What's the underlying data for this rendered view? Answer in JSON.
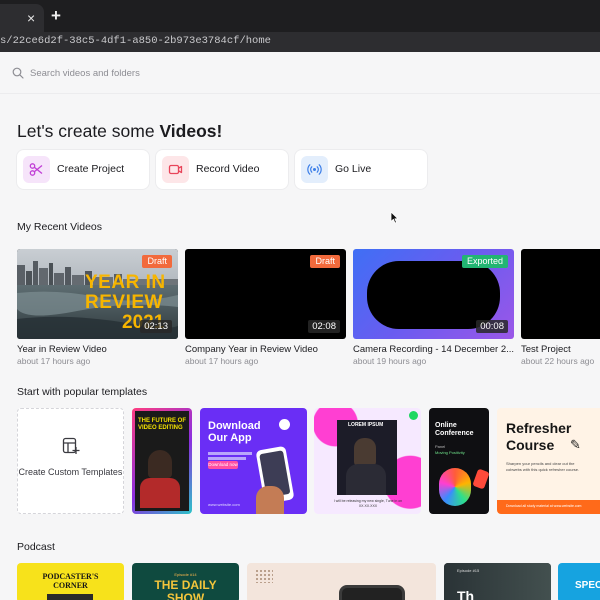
{
  "browser": {
    "tab_close": "×",
    "new_tab": "+",
    "url": "s/22ce6d2f-38c5-4df1-a850-2b973e3784cf/home"
  },
  "search": {
    "placeholder": "Search videos and folders"
  },
  "headline": {
    "prefix": "Let's create some ",
    "emphasis": "Videos!"
  },
  "actions": [
    {
      "label": "Create Project",
      "icon": "scissors-icon",
      "color": "#c13fd6"
    },
    {
      "label": "Record Video",
      "icon": "camera-icon",
      "color": "#e8455a"
    },
    {
      "label": "Go Live",
      "icon": "broadcast-icon",
      "color": "#3b7ee8"
    }
  ],
  "recent": {
    "title": "My Recent Videos",
    "videos": [
      {
        "title": "Year in Review Video",
        "meta": "about 17 hours ago",
        "badge": "Draft",
        "duration": "02:13",
        "thumb_lines": [
          "YEAR IN",
          "REVIEW",
          "2021"
        ]
      },
      {
        "title": "Company Year in Review Video",
        "meta": "about 17 hours ago",
        "badge": "Draft",
        "duration": "02:08"
      },
      {
        "title": "Camera Recording - 14 December 2...",
        "meta": "about 19 hours ago",
        "badge": "Exported",
        "duration": "00:08"
      },
      {
        "title": "Test Project",
        "meta": "about 22 hours ago"
      }
    ]
  },
  "templates": {
    "title": "Start with popular templates",
    "custom": "Create Custom Templates",
    "items": [
      {
        "lines": [
          "THE FUTURE OF",
          "VIDEO EDITING"
        ]
      },
      {
        "lines": [
          "Download",
          "Our App"
        ],
        "button": "Download now",
        "site": "www.website.com"
      },
      {
        "lines": [
          "LOREM IPSUM"
        ],
        "caption": "I will be releasing my new single, Tune in on XX.XX.XXX"
      },
      {
        "lines": [
          "Online",
          "Conference"
        ],
        "sub": "Panel",
        "sub2": "Moving Positivity"
      },
      {
        "lines": [
          "Refresher",
          "Course"
        ],
        "body": "Sharpen your pencils and clear out the cobwebs with this quick refresher course.",
        "footer": "Download all study material at www.website.com"
      }
    ]
  },
  "podcast": {
    "title": "Podcast",
    "items": [
      {
        "lines": [
          "PODCASTER'S",
          "CORNER"
        ]
      },
      {
        "lines": [
          "Episode #14",
          "THE DAILY",
          "SHOW"
        ]
      },
      {
        "lines": []
      },
      {
        "lines": [
          "Episode #15",
          "Th"
        ]
      },
      {
        "lines": [
          "SPEC"
        ]
      }
    ]
  }
}
